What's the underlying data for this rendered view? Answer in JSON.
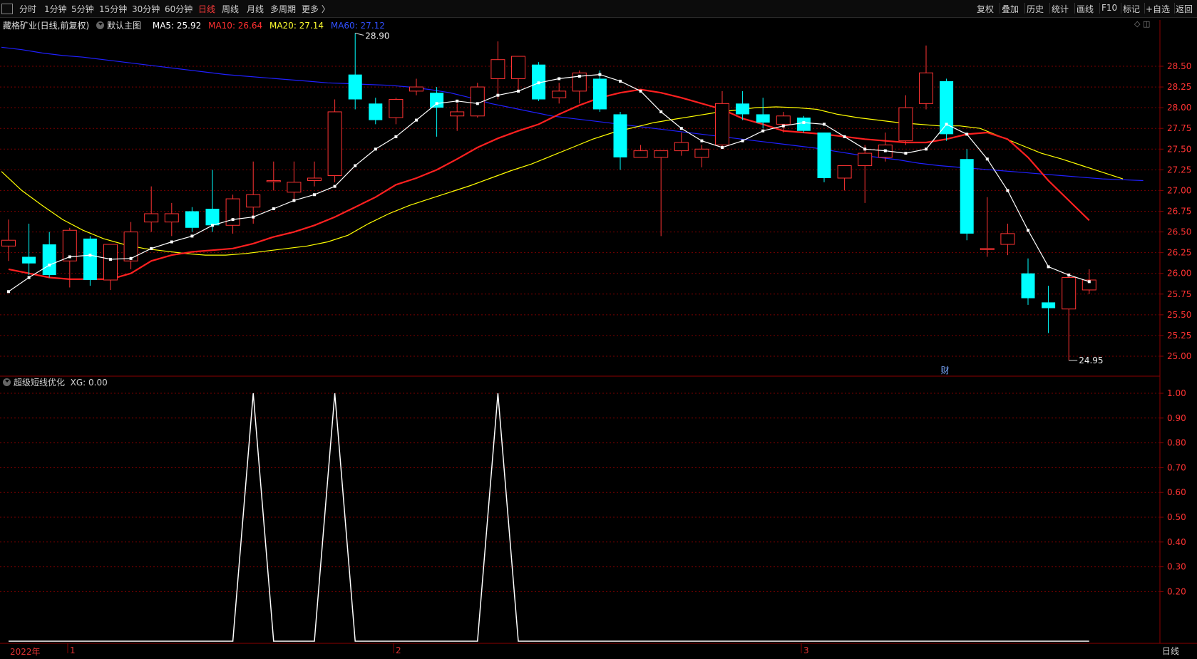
{
  "toolbar": {
    "periods": [
      "分时",
      "1分钟",
      "5分钟",
      "15分钟",
      "30分钟",
      "60分钟",
      "日线",
      "周线",
      "月线",
      "多周期",
      "更多 〉"
    ],
    "active_period": "日线",
    "right_items": [
      "复权",
      "叠加",
      "历史",
      "统计",
      "画线",
      "F10",
      "标记",
      "+自选",
      "返回"
    ]
  },
  "main_panel": {
    "stock_title": "藏格矿业(日线,前复权)",
    "template_name": "默认主图",
    "ma5_label": "MA5: 25.92",
    "ma10_label": "MA10: 26.64",
    "ma20_label": "MA20: 27.14",
    "ma60_label": "MA60: 27.12",
    "high_marker": "28.90",
    "low_marker": "24.95",
    "fin_marker": "财"
  },
  "indicator_panel": {
    "name": "超级短线优化",
    "value_label": "XG: 0.00"
  },
  "bottom": {
    "year_label": "2022年",
    "month_labels": [
      "1",
      "2",
      "3"
    ],
    "period_label": "日线"
  },
  "colors": {
    "up": "#ff3333",
    "down": "#00ffff",
    "ma5": "#ffffff",
    "ma10": "#ff2020",
    "ma20": "#ffff00",
    "ma60": "#2020ff",
    "grid": "#7a0000",
    "axis_text": "#ff3333"
  },
  "chart_data": [
    {
      "type": "candlestick",
      "ylim": [
        24.8,
        28.95
      ],
      "yticks": [
        "28.50",
        "28.25",
        "28.00",
        "27.75",
        "27.50",
        "27.25",
        "27.00",
        "26.75",
        "26.50",
        "26.25",
        "26.00",
        "25.75",
        "25.50",
        "25.25",
        "25.00"
      ],
      "candles": [
        {
          "o": 26.33,
          "h": 26.65,
          "l": 26.15,
          "c": 26.4
        },
        {
          "o": 26.2,
          "h": 26.6,
          "l": 25.98,
          "c": 26.12
        },
        {
          "o": 26.35,
          "h": 26.5,
          "l": 25.95,
          "c": 25.98
        },
        {
          "o": 26.15,
          "h": 26.55,
          "l": 25.83,
          "c": 26.52
        },
        {
          "o": 26.42,
          "h": 26.45,
          "l": 25.85,
          "c": 25.92
        },
        {
          "o": 25.92,
          "h": 26.3,
          "l": 25.8,
          "c": 26.35
        },
        {
          "o": 26.15,
          "h": 26.62,
          "l": 26.05,
          "c": 26.5
        },
        {
          "o": 26.62,
          "h": 27.05,
          "l": 26.5,
          "c": 26.72
        },
        {
          "o": 26.62,
          "h": 26.85,
          "l": 26.45,
          "c": 26.72
        },
        {
          "o": 26.75,
          "h": 26.8,
          "l": 26.5,
          "c": 26.55
        },
        {
          "o": 26.78,
          "h": 27.25,
          "l": 26.5,
          "c": 26.58
        },
        {
          "o": 26.58,
          "h": 26.95,
          "l": 26.48,
          "c": 26.9
        },
        {
          "o": 26.8,
          "h": 27.35,
          "l": 26.6,
          "c": 26.95
        },
        {
          "o": 27.12,
          "h": 27.35,
          "l": 27.0,
          "c": 27.12
        },
        {
          "o": 26.98,
          "h": 27.35,
          "l": 26.9,
          "c": 27.1
        },
        {
          "o": 27.12,
          "h": 27.35,
          "l": 27.05,
          "c": 27.15
        },
        {
          "o": 27.18,
          "h": 28.1,
          "l": 27.1,
          "c": 27.95
        },
        {
          "o": 28.4,
          "h": 28.9,
          "l": 27.98,
          "c": 28.1
        },
        {
          "o": 28.05,
          "h": 28.12,
          "l": 27.8,
          "c": 27.85
        },
        {
          "o": 27.88,
          "h": 28.12,
          "l": 27.8,
          "c": 28.1
        },
        {
          "o": 28.2,
          "h": 28.35,
          "l": 28.15,
          "c": 28.25
        },
        {
          "o": 28.18,
          "h": 28.25,
          "l": 27.65,
          "c": 28.0
        },
        {
          "o": 27.9,
          "h": 28.05,
          "l": 27.72,
          "c": 27.95
        },
        {
          "o": 27.9,
          "h": 28.3,
          "l": 27.88,
          "c": 28.25
        },
        {
          "o": 28.35,
          "h": 28.8,
          "l": 28.1,
          "c": 28.58
        },
        {
          "o": 28.35,
          "h": 28.62,
          "l": 28.2,
          "c": 28.62
        },
        {
          "o": 28.52,
          "h": 28.55,
          "l": 28.08,
          "c": 28.1
        },
        {
          "o": 28.12,
          "h": 28.3,
          "l": 28.05,
          "c": 28.2
        },
        {
          "o": 28.2,
          "h": 28.45,
          "l": 28.05,
          "c": 28.42
        },
        {
          "o": 28.35,
          "h": 28.45,
          "l": 27.95,
          "c": 27.98
        },
        {
          "o": 27.92,
          "h": 27.95,
          "l": 27.25,
          "c": 27.4
        },
        {
          "o": 27.4,
          "h": 27.55,
          "l": 27.4,
          "c": 27.48
        },
        {
          "o": 27.4,
          "h": 27.48,
          "l": 26.45,
          "c": 27.48
        },
        {
          "o": 27.48,
          "h": 27.7,
          "l": 27.42,
          "c": 27.58
        },
        {
          "o": 27.4,
          "h": 27.55,
          "l": 27.28,
          "c": 27.5
        },
        {
          "o": 27.55,
          "h": 28.2,
          "l": 27.5,
          "c": 28.05
        },
        {
          "o": 28.05,
          "h": 28.2,
          "l": 27.85,
          "c": 27.92
        },
        {
          "o": 27.92,
          "h": 28.12,
          "l": 27.75,
          "c": 27.82
        },
        {
          "o": 27.8,
          "h": 27.95,
          "l": 27.7,
          "c": 27.9
        },
        {
          "o": 27.88,
          "h": 27.9,
          "l": 27.7,
          "c": 27.72
        },
        {
          "o": 27.7,
          "h": 27.7,
          "l": 27.1,
          "c": 27.15
        },
        {
          "o": 27.15,
          "h": 27.3,
          "l": 27.0,
          "c": 27.3
        },
        {
          "o": 27.3,
          "h": 27.55,
          "l": 26.85,
          "c": 27.45
        },
        {
          "o": 27.4,
          "h": 27.7,
          "l": 27.35,
          "c": 27.55
        },
        {
          "o": 27.6,
          "h": 28.15,
          "l": 27.55,
          "c": 28.0
        },
        {
          "o": 28.05,
          "h": 28.75,
          "l": 27.98,
          "c": 28.42
        },
        {
          "o": 28.32,
          "h": 28.35,
          "l": 27.6,
          "c": 27.68
        },
        {
          "o": 27.38,
          "h": 27.5,
          "l": 26.4,
          "c": 26.48
        },
        {
          "o": 26.3,
          "h": 26.92,
          "l": 26.2,
          "c": 26.3
        },
        {
          "o": 26.35,
          "h": 26.6,
          "l": 26.22,
          "c": 26.48
        },
        {
          "o": 26.0,
          "h": 26.18,
          "l": 25.62,
          "c": 25.7
        },
        {
          "o": 25.65,
          "h": 25.85,
          "l": 25.28,
          "c": 25.58
        },
        {
          "o": 25.57,
          "h": 25.97,
          "l": 24.95,
          "c": 25.95
        },
        {
          "o": 25.8,
          "h": 26.05,
          "l": 25.75,
          "c": 25.92
        }
      ],
      "ma5": [
        25.78,
        25.95,
        26.1,
        26.2,
        26.22,
        26.17,
        26.18,
        26.3,
        26.38,
        26.45,
        26.58,
        26.65,
        26.68,
        26.78,
        26.88,
        26.95,
        27.05,
        27.3,
        27.5,
        27.65,
        27.85,
        28.05,
        28.08,
        28.05,
        28.15,
        28.2,
        28.3,
        28.35,
        28.38,
        28.4,
        28.32,
        28.2,
        27.95,
        27.75,
        27.6,
        27.52,
        27.6,
        27.72,
        27.78,
        27.82,
        27.8,
        27.65,
        27.5,
        27.48,
        27.45,
        27.5,
        27.8,
        27.68,
        27.38,
        27.0,
        26.52,
        26.08,
        25.98,
        25.9
      ],
      "ma10": [
        26.05,
        26.0,
        25.95,
        25.93,
        25.93,
        25.93,
        26.0,
        26.15,
        26.22,
        26.26,
        26.28,
        26.3,
        26.36,
        26.44,
        26.5,
        26.58,
        26.68,
        26.8,
        26.92,
        27.07,
        27.15,
        27.25,
        27.38,
        27.52,
        27.63,
        27.72,
        27.8,
        27.92,
        28.03,
        28.12,
        28.18,
        28.22,
        28.18,
        28.12,
        28.05,
        27.98,
        27.87,
        27.8,
        27.72,
        27.7,
        27.68,
        27.65,
        27.62,
        27.6,
        27.58,
        27.58,
        27.62,
        27.68,
        27.7,
        27.62,
        27.4,
        27.12,
        26.88,
        26.64
      ],
      "ma20": [
        27.23,
        27.0,
        26.82,
        26.65,
        26.52,
        26.42,
        26.35,
        26.3,
        26.27,
        26.24,
        26.22,
        26.22,
        26.24,
        26.27,
        26.3,
        26.33,
        26.38,
        26.46,
        26.6,
        26.72,
        26.82,
        26.9,
        26.98,
        27.06,
        27.15,
        27.24,
        27.32,
        27.42,
        27.52,
        27.62,
        27.7,
        27.76,
        27.82,
        27.86,
        27.9,
        27.94,
        27.97,
        28.0,
        28.01,
        28.0,
        27.98,
        27.92,
        27.88,
        27.85,
        27.82,
        27.8,
        27.78,
        27.78,
        27.75,
        27.65,
        27.55,
        27.45,
        27.38,
        27.3,
        27.22,
        27.14
      ],
      "ma60": [
        28.73,
        28.7,
        28.66,
        28.63,
        28.61,
        28.58,
        28.55,
        28.52,
        28.49,
        28.46,
        28.43,
        28.4,
        28.38,
        28.36,
        28.34,
        28.32,
        28.3,
        28.29,
        28.28,
        28.27,
        28.25,
        28.22,
        28.18,
        28.12,
        28.05,
        28.0,
        27.95,
        27.9,
        27.87,
        27.84,
        27.81,
        27.78,
        27.75,
        27.72,
        27.69,
        27.66,
        27.63,
        27.6,
        27.57,
        27.54,
        27.51,
        27.47,
        27.43,
        27.4,
        27.37,
        27.33,
        27.3,
        27.28,
        27.26,
        27.24,
        27.22,
        27.2,
        27.18,
        27.16,
        27.14,
        27.13,
        27.12
      ]
    },
    {
      "type": "line",
      "name": "XG",
      "ylim": [
        0,
        1.05
      ],
      "yticks": [
        "1.00",
        "0.90",
        "0.80",
        "0.70",
        "0.60",
        "0.50",
        "0.40",
        "0.30",
        "0.20"
      ],
      "values": [
        0,
        0,
        0,
        0,
        0,
        0,
        0,
        0,
        0,
        0,
        0,
        0,
        1,
        0,
        0,
        0,
        1,
        0,
        0,
        0,
        0,
        0,
        0,
        0,
        1,
        0,
        0,
        0,
        0,
        0,
        0,
        0,
        0,
        0,
        0,
        0,
        0,
        0,
        0,
        0,
        0,
        0,
        0,
        0,
        0,
        0,
        0,
        0,
        0,
        0,
        0,
        0,
        0,
        0
      ]
    }
  ]
}
